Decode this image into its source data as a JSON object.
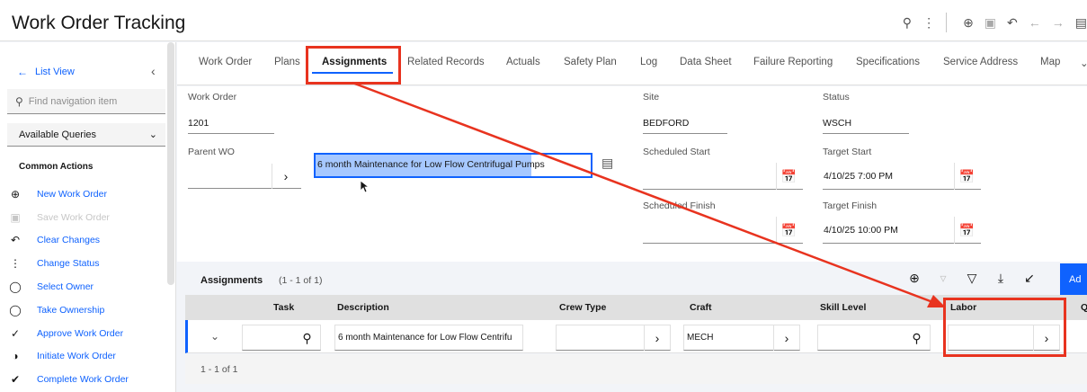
{
  "header": {
    "title": "Work Order Tracking",
    "icons": [
      "search-icon",
      "overflow-icon",
      "add-icon",
      "save-icon",
      "undo-icon",
      "back-arrow-icon",
      "forward-arrow-icon",
      "document-icon"
    ]
  },
  "sidebar": {
    "list_view": "List View",
    "search_placeholder": "Find navigation item",
    "queries_label": "Available Queries",
    "common_actions_title": "Common Actions",
    "actions": [
      {
        "label": "New Work Order",
        "icon": "add-circle-icon",
        "disabled": false
      },
      {
        "label": "Save Work Order",
        "icon": "save-icon",
        "disabled": true
      },
      {
        "label": "Clear Changes",
        "icon": "undo-icon",
        "disabled": false
      },
      {
        "label": "Change Status",
        "icon": "status-icon",
        "disabled": false
      },
      {
        "label": "Select Owner",
        "icon": "user-icon",
        "disabled": false
      },
      {
        "label": "Take Ownership",
        "icon": "user-check-icon",
        "disabled": false
      },
      {
        "label": "Approve Work Order",
        "icon": "checkmark-icon",
        "disabled": false
      },
      {
        "label": "Initiate Work Order",
        "icon": "half-circle-icon",
        "disabled": false
      },
      {
        "label": "Complete Work Order",
        "icon": "checkmark-circle-icon",
        "disabled": false
      }
    ]
  },
  "tabs": [
    "Work Order",
    "Plans",
    "Assignments",
    "Related Records",
    "Actuals",
    "Safety Plan",
    "Log",
    "Data Sheet",
    "Failure Reporting",
    "Specifications",
    "Service Address",
    "Map"
  ],
  "active_tab": "Assignments",
  "form": {
    "work_order_label": "Work Order",
    "work_order_value": "1201",
    "description_value": "6 month Maintenance for Low Flow Centrifugal Pumps",
    "parent_wo_label": "Parent WO",
    "site_label": "Site",
    "site_value": "BEDFORD",
    "status_label": "Status",
    "status_value": "WSCH",
    "scheduled_start_label": "Scheduled Start",
    "target_start_label": "Target Start",
    "target_start_value": "4/10/25 7:00 PM",
    "scheduled_finish_label": "Scheduled Finish",
    "target_finish_label": "Target Finish",
    "target_finish_value": "4/10/25 10:00 PM"
  },
  "assignments": {
    "title": "Assignments",
    "count": "(1 - 1 of 1)",
    "add_label": "Ad",
    "columns": [
      "Task",
      "Description",
      "Crew Type",
      "Craft",
      "Skill Level",
      "Labor",
      "Q"
    ],
    "row": {
      "description": "6 month Maintenance for Low Flow Centrifu",
      "craft": "MECH"
    },
    "footer": "1 - 1 of 1"
  },
  "colors": {
    "accent": "#0f62fe",
    "annotation": "#e8331f"
  }
}
